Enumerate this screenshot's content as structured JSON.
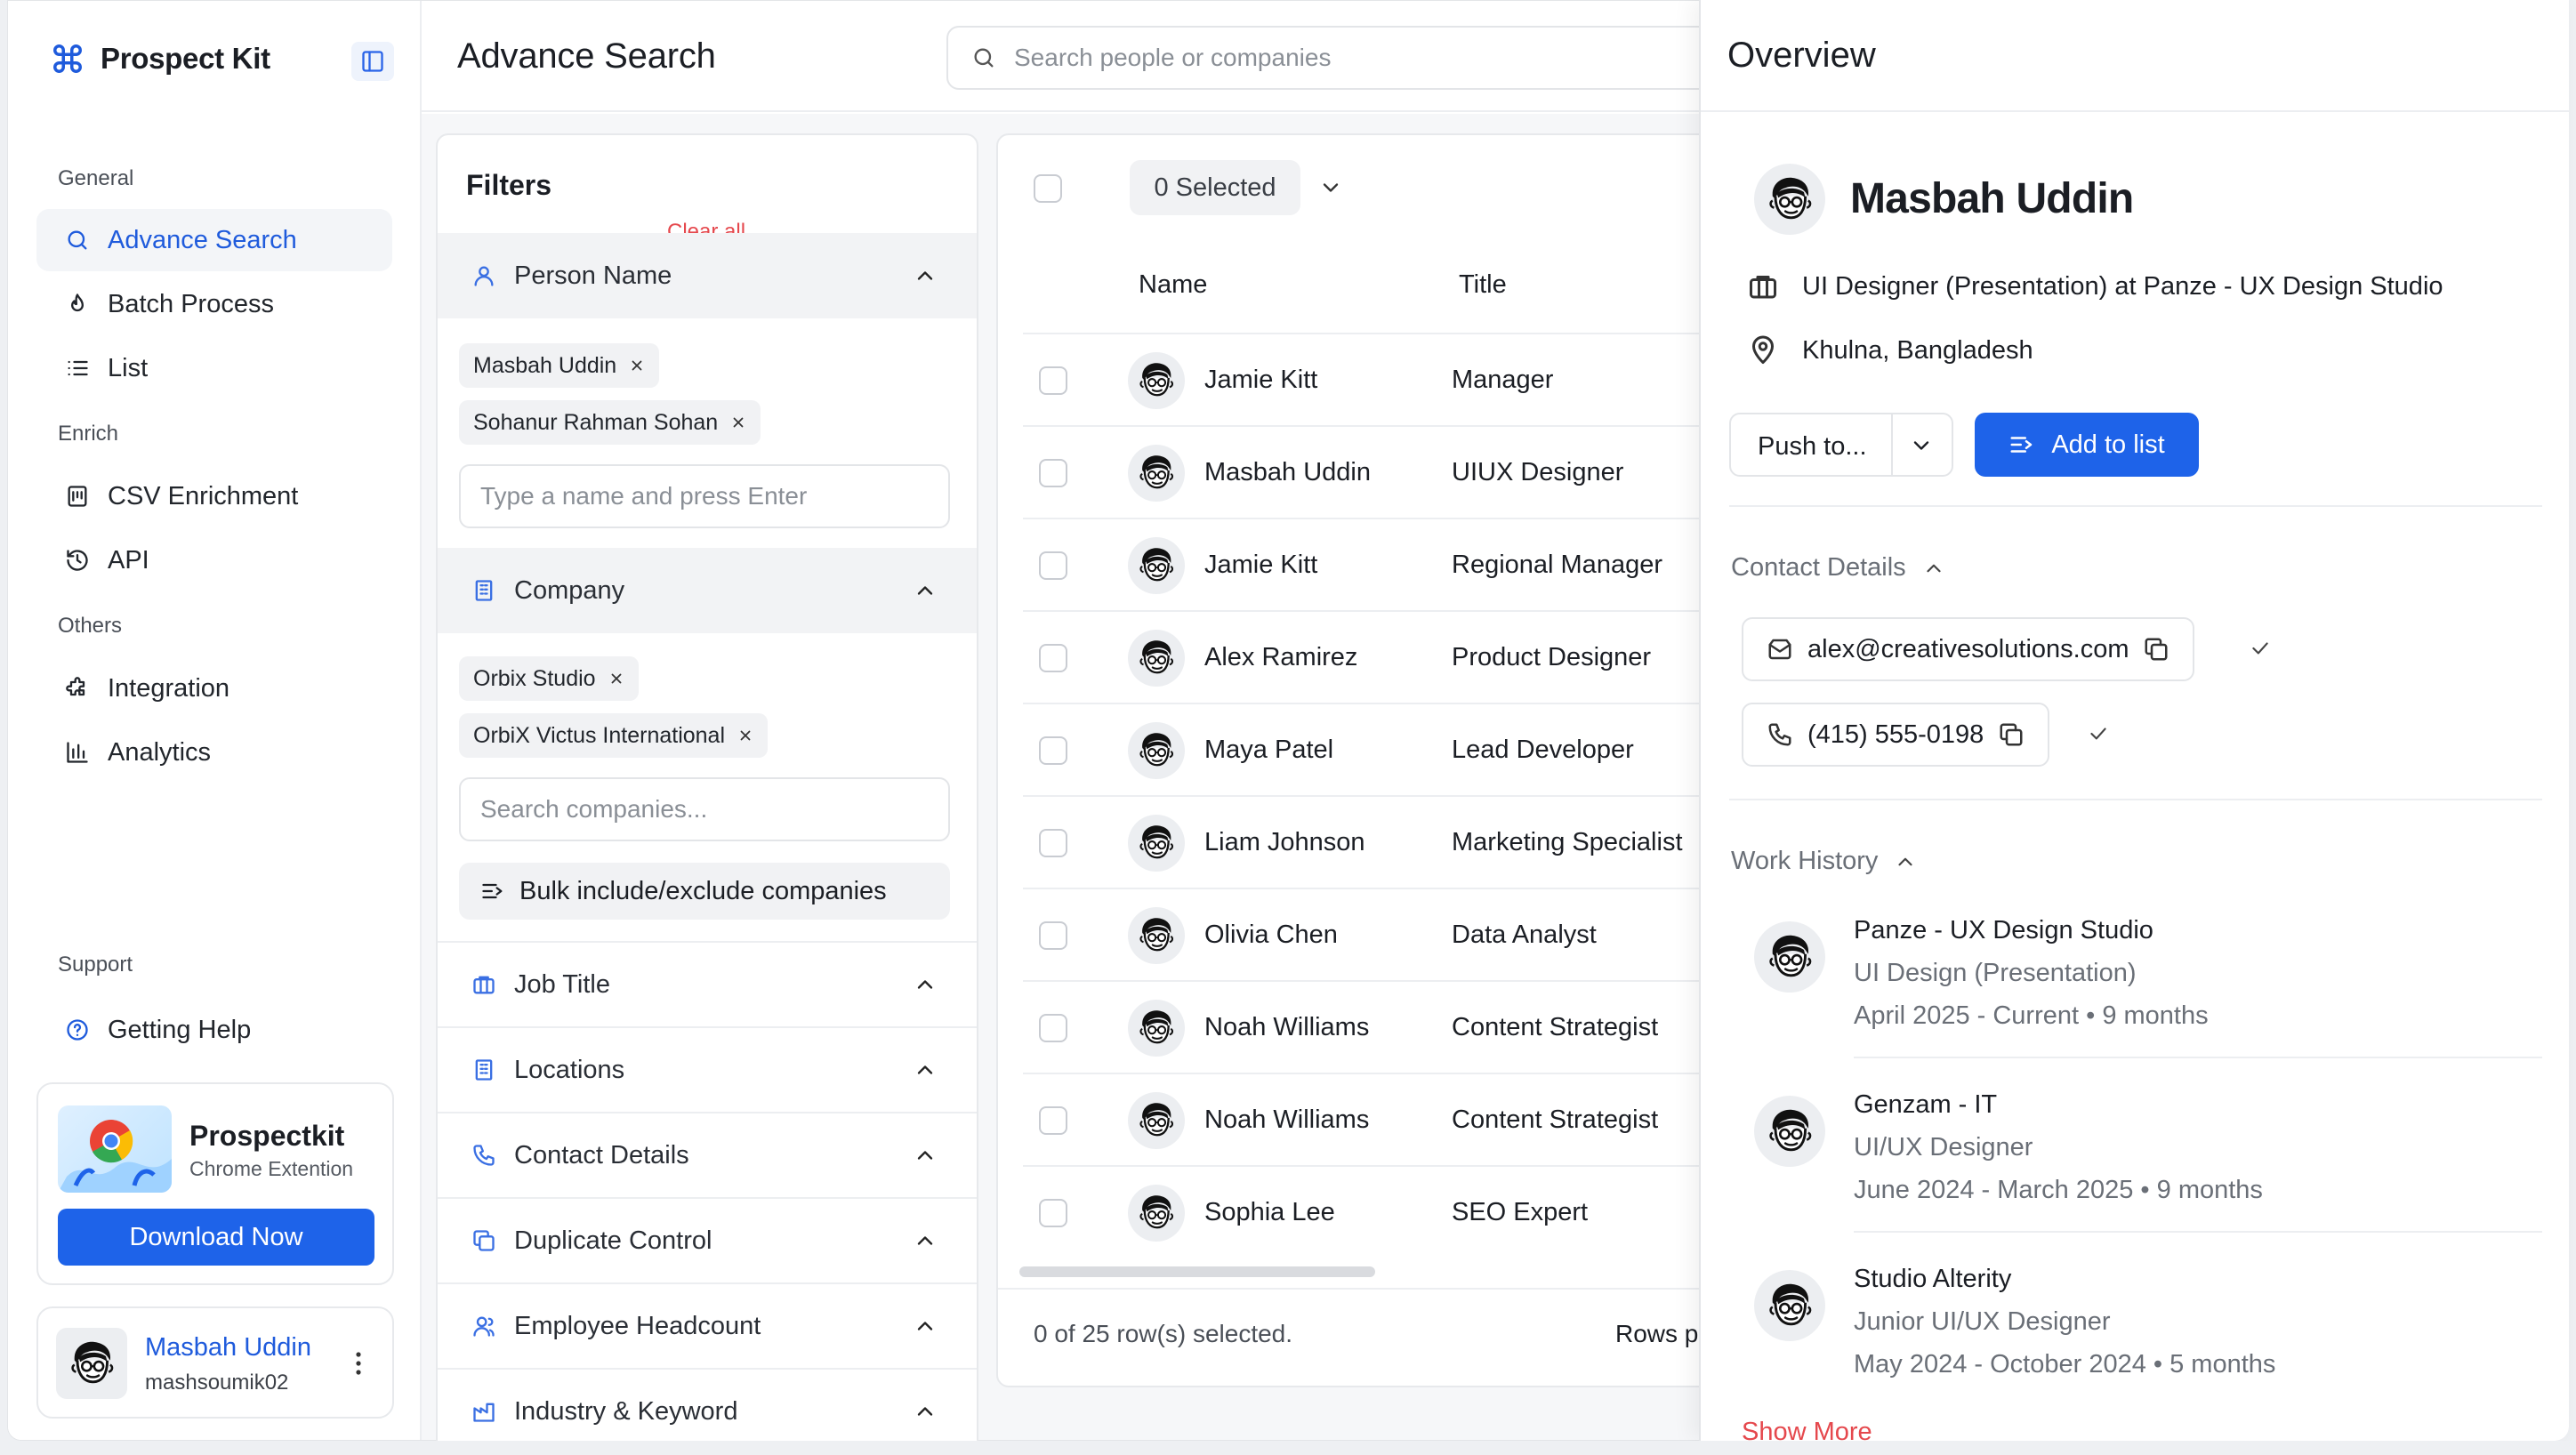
{
  "app": {
    "name": "Prospect Kit"
  },
  "sidebar": {
    "sections": [
      {
        "label": "General",
        "items": [
          {
            "label": "Advance Search",
            "icon": "search-icon",
            "active": true
          },
          {
            "label": "Batch Process",
            "icon": "flame-icon"
          },
          {
            "label": "List",
            "icon": "list-icon"
          }
        ]
      },
      {
        "label": "Enrich",
        "items": [
          {
            "label": "CSV Enrichment",
            "icon": "csv-icon"
          },
          {
            "label": "API",
            "icon": "history-icon"
          }
        ]
      },
      {
        "label": "Others",
        "items": [
          {
            "label": "Integration",
            "icon": "puzzle-icon"
          },
          {
            "label": "Analytics",
            "icon": "bar-chart-icon"
          }
        ]
      },
      {
        "label": "Support",
        "items": [
          {
            "label": "Getting Help",
            "icon": "help-icon"
          }
        ]
      }
    ],
    "promo": {
      "title": "Prospectkit",
      "subtitle": "Chrome Extention",
      "button": "Download Now"
    },
    "user": {
      "name": "Masbah Uddin",
      "handle": "mashsoumik02"
    }
  },
  "header": {
    "title": "Advance Search",
    "search_placeholder": "Search people or companies"
  },
  "filters": {
    "title": "Filters",
    "clear_all": "Clear all",
    "person_name": {
      "label": "Person Name",
      "chips": [
        "Masbah Uddin",
        "Sohanur Rahman Sohan"
      ],
      "placeholder": "Type a name and press Enter"
    },
    "company": {
      "label": "Company",
      "chips": [
        "Orbix Studio",
        "OrbiX Victus International"
      ],
      "placeholder": "Search companies...",
      "bulk": "Bulk include/exclude companies"
    },
    "groups": [
      "Job Title",
      "Locations",
      "Contact Details",
      "Duplicate Control",
      "Employee Headcount",
      "Industry & Keyword"
    ]
  },
  "table": {
    "selected_label": "0 Selected",
    "columns": [
      "Name",
      "Title"
    ],
    "rows": [
      {
        "name": "Jamie Kitt",
        "title": "Manager"
      },
      {
        "name": "Masbah Uddin",
        "title": "UIUX Designer"
      },
      {
        "name": "Jamie Kitt",
        "title": "Regional Manager"
      },
      {
        "name": "Alex Ramirez",
        "title": "Product Designer"
      },
      {
        "name": "Maya Patel",
        "title": "Lead Developer"
      },
      {
        "name": "Liam Johnson",
        "title": "Marketing Specialist"
      },
      {
        "name": "Olivia Chen",
        "title": "Data Analyst"
      },
      {
        "name": "Noah Williams",
        "title": "Content Strategist"
      },
      {
        "name": "Noah Williams",
        "title": "Content Strategist"
      },
      {
        "name": "Sophia Lee",
        "title": "SEO Expert"
      }
    ],
    "footer": "0 of 25 row(s) selected.",
    "rows_per_page": "Rows p"
  },
  "overview": {
    "title": "Overview",
    "name": "Masbah Uddin",
    "headline": "UI Designer (Presentation) at Panze - UX Design Studio",
    "location": "Khulna, Bangladesh",
    "push_label": "Push to...",
    "add_label": "Add to list",
    "contact_heading": "Contact Details",
    "email": "alex@creativesolutions.com",
    "phone": "(415) 555-0198",
    "work_heading": "Work History",
    "work": [
      {
        "company": "Panze - UX Design Studio",
        "role": "UI Design (Presentation)",
        "dates": "April 2025 - Current • 9 months"
      },
      {
        "company": "Genzam - IT",
        "role": "UI/UX Designer",
        "dates": "June 2024 - March 2025 • 9 months"
      },
      {
        "company": "Studio Alterity",
        "role": "Junior UI/UX Designer",
        "dates": "May 2024 - October 2024 • 5 months"
      }
    ],
    "show_more": "Show More"
  },
  "colors": {
    "accent": "#1e63e9",
    "danger": "#e5484d",
    "active_nav_bg": "#f3f5f8"
  }
}
